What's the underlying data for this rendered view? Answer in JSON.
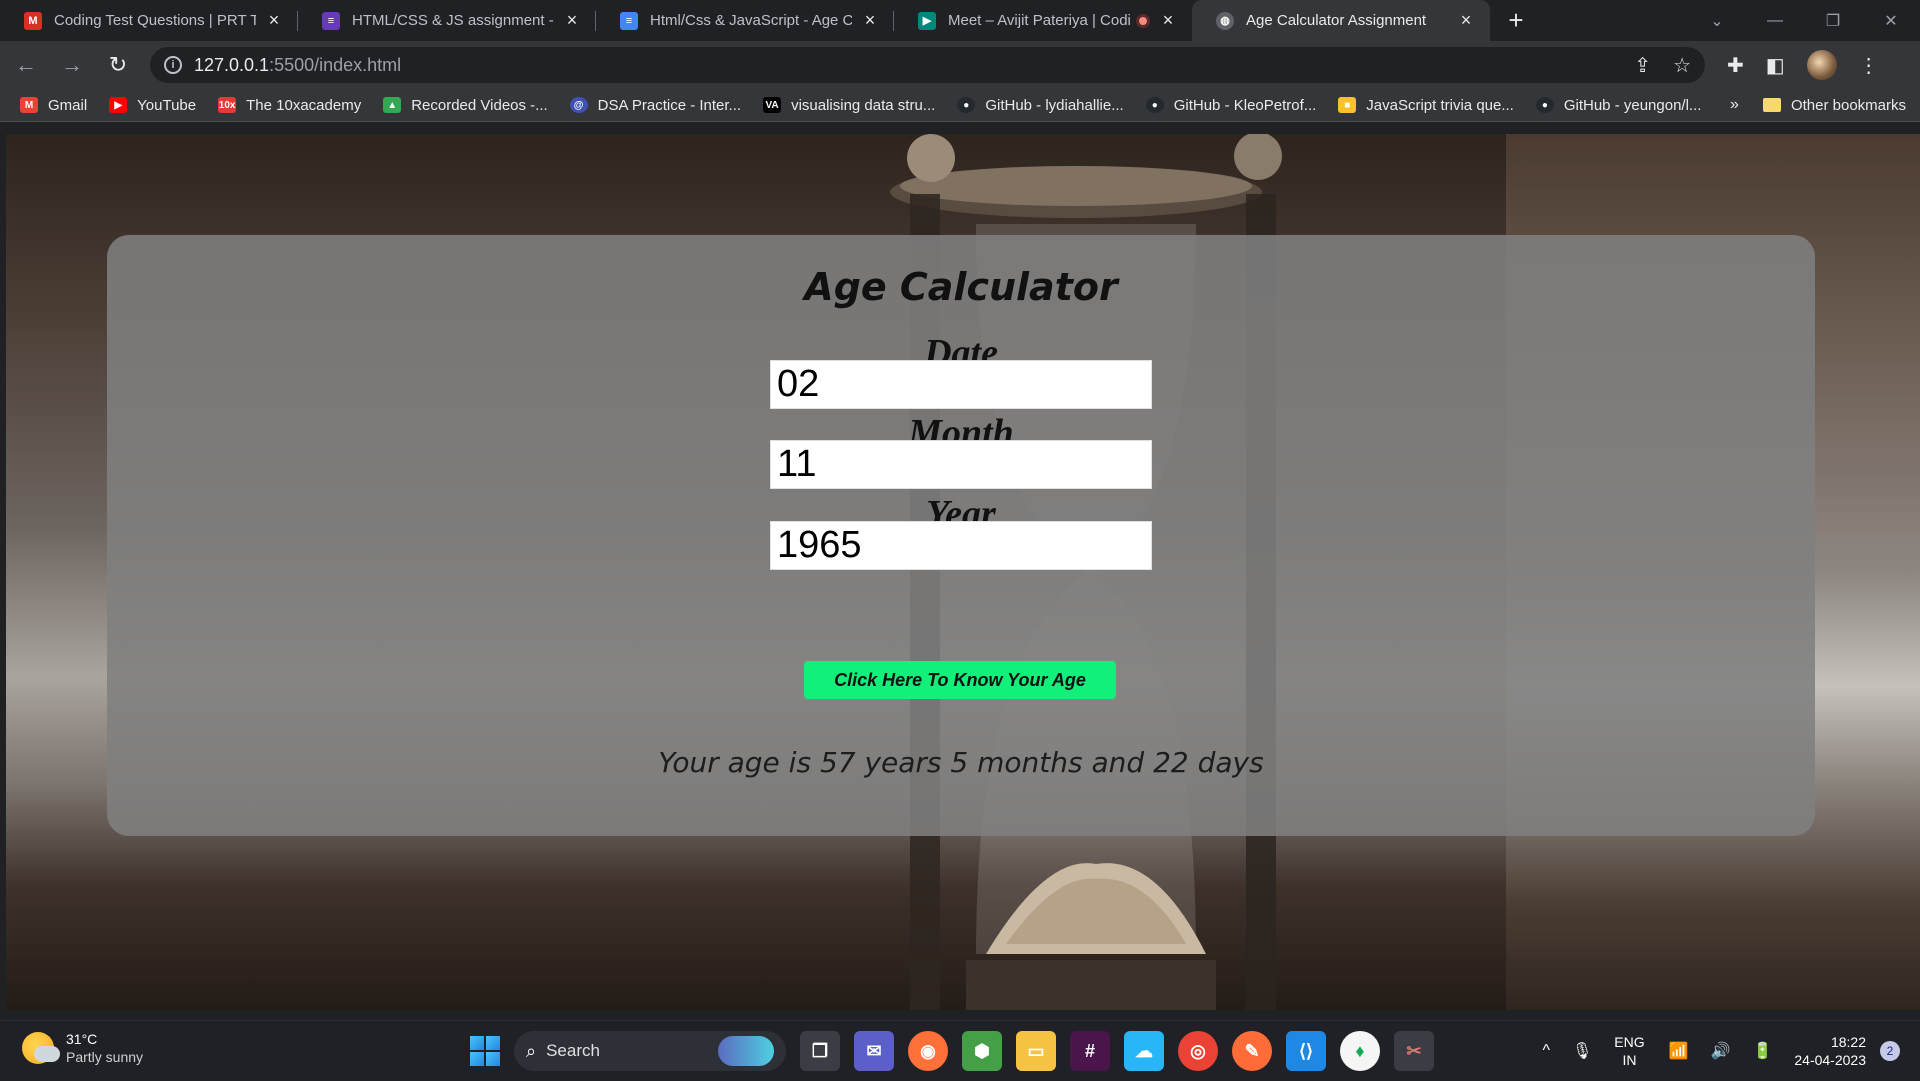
{
  "tabs": [
    {
      "title": "Coding Test Questions | PRT Test",
      "icon": "gmail-icon",
      "color": "#d93025",
      "active": false
    },
    {
      "title": "HTML/CSS & JS assignment - Ag",
      "icon": "forms-icon",
      "color": "#673ab7",
      "active": false
    },
    {
      "title": "Html/Css & JavaScript - Age Calc",
      "icon": "docs-icon",
      "color": "#4285f4",
      "active": false
    },
    {
      "title": "Meet – Avijit Pateriya | Codin",
      "icon": "meet-icon",
      "color": "#00897b",
      "active": false
    },
    {
      "title": "Age Calculator Assignment",
      "icon": "globe-icon",
      "color": "#5f6368",
      "active": true
    }
  ],
  "address_bar": {
    "host": "127.0.0.1",
    "path": ":5500/index.html"
  },
  "bookmarks": [
    {
      "label": "Gmail",
      "icon": "M",
      "color": "#ea4335"
    },
    {
      "label": "YouTube",
      "icon": "▶",
      "color": "#ff0000"
    },
    {
      "label": "The 10xacademy",
      "icon": "10x",
      "color": "#e53935"
    },
    {
      "label": "Recorded Videos -...",
      "icon": "▲",
      "color": "#34a853"
    },
    {
      "label": "DSA Practice - Inter...",
      "icon": "@",
      "color": "#3f51b5"
    },
    {
      "label": "visualising data stru...",
      "icon": "VA",
      "color": "#000000"
    },
    {
      "label": "GitHub - lydiahallie...",
      "icon": "●",
      "color": "#24292e"
    },
    {
      "label": "GitHub - KleoPetrof...",
      "icon": "●",
      "color": "#24292e"
    },
    {
      "label": "JavaScript trivia que...",
      "icon": "■",
      "color": "#fbc02d"
    },
    {
      "label": "GitHub - yeungon/l...",
      "icon": "●",
      "color": "#24292e"
    }
  ],
  "bookmarks_more": "»",
  "other_bookmarks": "Other bookmarks",
  "app": {
    "title": "Age Calculator",
    "date_label": "Date",
    "date_value": "02",
    "month_label": "Month",
    "month_value": "11",
    "year_label": "Year",
    "year_value": "1965",
    "button_label": "Click Here To Know Your Age",
    "result": "Your age is 57 years 5 months and 22 days",
    "button_color": "#10f07a"
  },
  "taskbar": {
    "temperature": "31°C",
    "weather": "Partly sunny",
    "search_label": "Search",
    "language": "ENG",
    "region": "IN",
    "time": "18:22",
    "date": "24-04-2023",
    "notifications": "2"
  }
}
